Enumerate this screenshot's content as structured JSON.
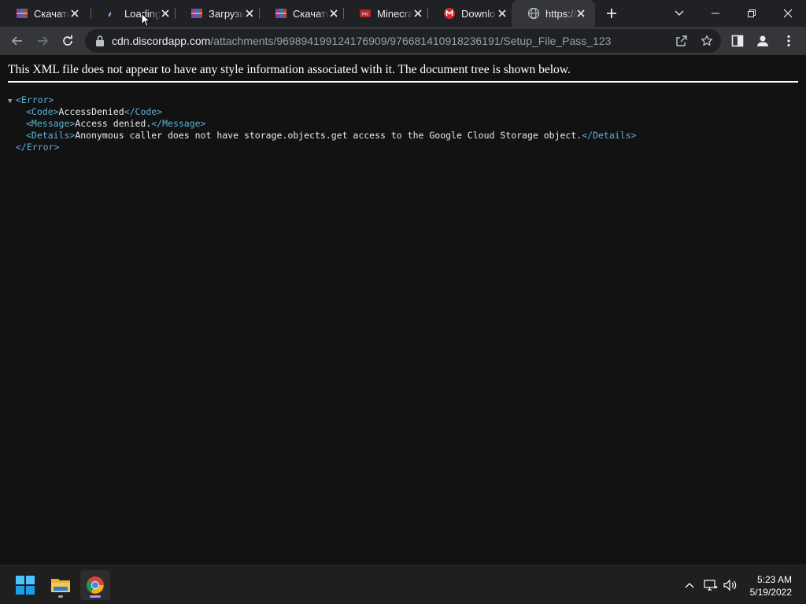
{
  "browser": {
    "tabs": [
      {
        "title": "Скачать",
        "icon": "winrar-icon",
        "active": false
      },
      {
        "title": "Loading",
        "icon": "loading-spinner-icon",
        "active": false
      },
      {
        "title": "Загрузи",
        "icon": "winrar-icon",
        "active": false
      },
      {
        "title": "Скачать",
        "icon": "winrar-icon",
        "active": false
      },
      {
        "title": "Minecra",
        "icon": "minecraft-icon",
        "active": false
      },
      {
        "title": "Downlo",
        "icon": "mega-icon",
        "active": false
      },
      {
        "title": "https://",
        "icon": "globe-icon",
        "active": true
      }
    ],
    "address_bar": {
      "host": "cdn.discordapp.com",
      "path": "/attachments/969894199124176909/976681410918236191/Setup_File_Pass_123"
    }
  },
  "page": {
    "notice": "This XML file does not appear to have any style information associated with it. The document tree is shown below.",
    "xml_tree": {
      "root_open": "<Error>",
      "code_open": "<Code>",
      "code_value": "AccessDenied",
      "code_close": "</Code>",
      "message_open": "<Message>",
      "message_value": "Access denied.",
      "message_close": "</Message>",
      "details_open": "<Details>",
      "details_value": "Anonymous caller does not have storage.objects.get access to the Google Cloud Storage object.",
      "details_close": "</Details>",
      "root_close": "</Error>"
    }
  },
  "taskbar": {
    "apps": [
      "windows-start-icon",
      "file-explorer-icon",
      "chrome-icon"
    ],
    "clock": {
      "time": "5:23 AM",
      "date": "5/19/2022"
    }
  },
  "colors": {
    "tag": "#5db0d7",
    "background": "#121212",
    "tab_active": "#35363a"
  }
}
